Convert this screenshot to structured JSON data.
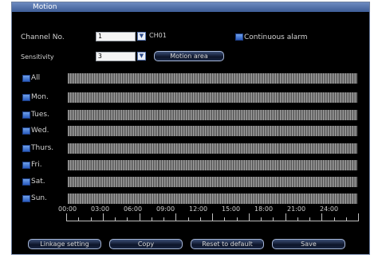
{
  "window": {
    "title": "Motion"
  },
  "channel": {
    "label": "Channel No.",
    "value": "1",
    "name": "CH01"
  },
  "continuous": {
    "label": "Continuous alarm"
  },
  "sensitivity": {
    "label": "Sensitivity",
    "value": "3"
  },
  "motion_area_label": "Motion area",
  "days": [
    "All",
    "Mon.",
    "Tues.",
    "Wed.",
    "Thurs.",
    "Fri.",
    "Sat.",
    "Sun."
  ],
  "times": [
    "00:00",
    "03:00",
    "06:00",
    "09:00",
    "12:00",
    "15:00",
    "18:00",
    "21:00",
    "24:00"
  ],
  "buttons": {
    "linkage": "Linkage setting",
    "copy": "Copy",
    "reset": "Reset to default",
    "save": "Save"
  },
  "colors": {
    "title_bar": "#4a6aa8",
    "checkbox": "#2f66c8",
    "schedule_bar": "#9c9c9c"
  }
}
